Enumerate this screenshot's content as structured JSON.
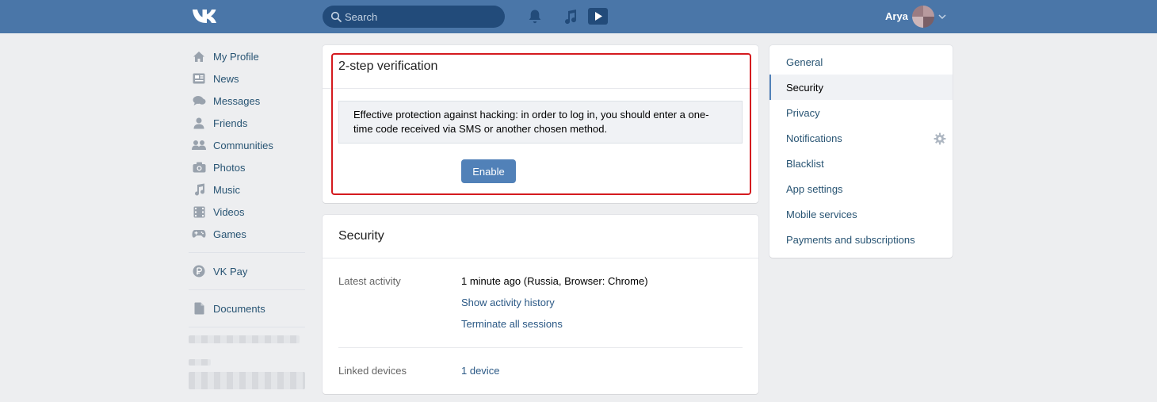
{
  "header": {
    "logo": "VK",
    "search_placeholder": "Search",
    "icons": [
      "bell-icon",
      "music-note-icon",
      "play-icon"
    ],
    "user_name": "Arya"
  },
  "leftnav": {
    "items": [
      {
        "label": "My Profile",
        "icon": "home-icon"
      },
      {
        "label": "News",
        "icon": "news-icon"
      },
      {
        "label": "Messages",
        "icon": "messages-icon"
      },
      {
        "label": "Friends",
        "icon": "friend-icon"
      },
      {
        "label": "Communities",
        "icon": "communities-icon"
      },
      {
        "label": "Photos",
        "icon": "camera-icon"
      },
      {
        "label": "Music",
        "icon": "music-icon"
      },
      {
        "label": "Videos",
        "icon": "film-icon"
      },
      {
        "label": "Games",
        "icon": "gamepad-icon"
      }
    ],
    "vkpay": "VK Pay",
    "documents": "Documents"
  },
  "twostep": {
    "title": "2-step verification",
    "description": "Effective protection against hacking: in order to log in, you should enter a one-time code received via SMS or another chosen method.",
    "button": "Enable"
  },
  "security": {
    "title": "Security",
    "latest_activity_label": "Latest activity",
    "latest_activity_value": "1 minute ago (Russia, Browser: Chrome)",
    "show_history": "Show activity history",
    "terminate_sessions": "Terminate all sessions",
    "linked_devices_label": "Linked devices",
    "linked_devices_value": "1 device"
  },
  "settings_menu": {
    "items": [
      "General",
      "Security",
      "Privacy",
      "Notifications",
      "Blacklist",
      "App settings",
      "Mobile services",
      "Payments and subscriptions"
    ],
    "active": "Security"
  },
  "colors": {
    "header_bg": "#4a76a8",
    "page_bg": "#edeef0",
    "link": "#2a5885",
    "button": "#5181b8",
    "highlight": "#d41a1f"
  }
}
